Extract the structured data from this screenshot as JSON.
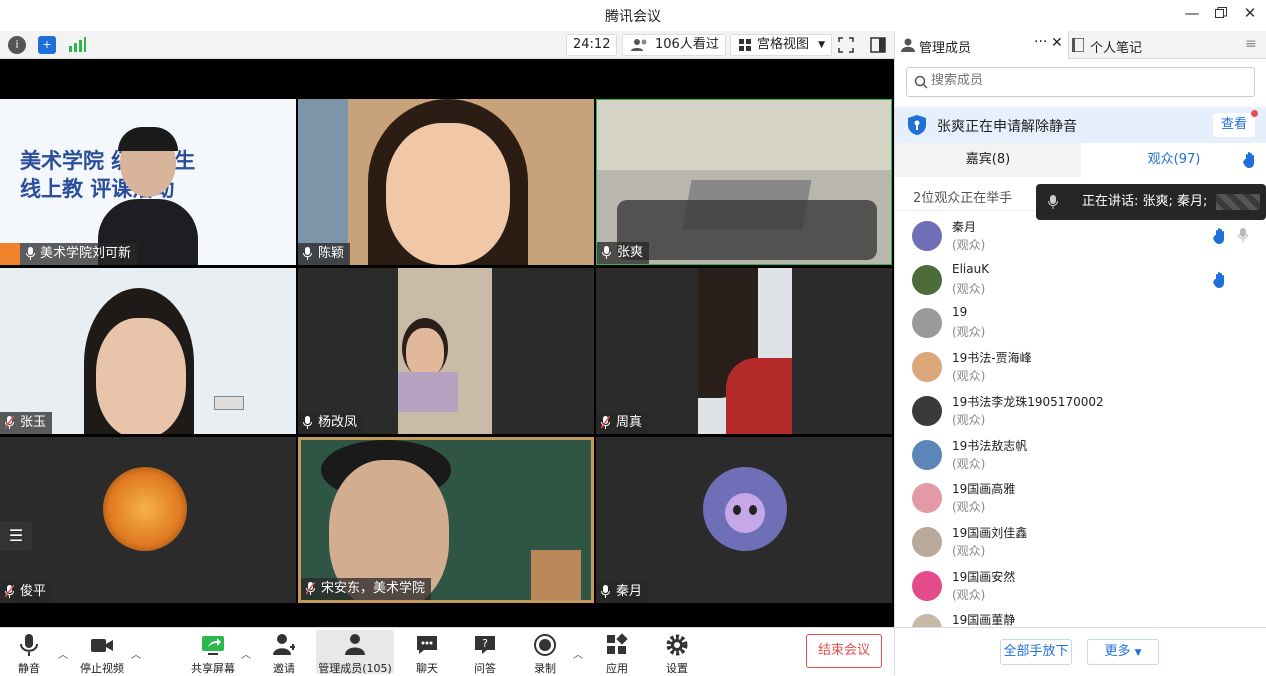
{
  "window": {
    "title": "腾讯会议"
  },
  "toolbar": {
    "timer": "24:12",
    "viewers": "106人看过",
    "view_mode": "宫格视图"
  },
  "tiles": [
    {
      "name": "美术学院刘可新",
      "bg": "#f4f7fb",
      "banner": "美术学院 级师范生\n线上教 评课活动"
    },
    {
      "name": "陈颖",
      "bg": "#c8a27a"
    },
    {
      "name": "张爽",
      "bg": "#7b7a72"
    },
    {
      "name": "张玉",
      "bg": "#e9eef3"
    },
    {
      "name": "杨改凤",
      "bg": "#2b2b2b"
    },
    {
      "name": "周真",
      "bg": "#2b2b2b"
    },
    {
      "name": "俊平",
      "bg": "#2b2b2b"
    },
    {
      "name": "宋安东，美术学院",
      "bg": "#2f5545"
    },
    {
      "name": "秦月",
      "bg": "#2b2b2b"
    }
  ],
  "right_panel": {
    "tab_members": "管理成员",
    "tab_notes": "个人笔记",
    "search_placeholder": "搜索成员",
    "unmute_request": "张爽正在申请解除静音",
    "view_label": "查看",
    "guests_tab": "嘉宾(8)",
    "audience_tab": "观众(97)",
    "handup_count": "2位观众正在举手",
    "speaking": "正在讲话: 张爽; 秦月;",
    "members": [
      {
        "name": "秦月",
        "role": "(观众)",
        "color": "#6f6fb8",
        "hand": true
      },
      {
        "name": "EliauK",
        "role": "(观众)",
        "color": "#4c6b3a",
        "hand": true
      },
      {
        "name": "19",
        "role": "(观众)",
        "color": "#9a9a9a",
        "hand": false
      },
      {
        "name": "19书法-贾海峰",
        "role": "(观众)",
        "color": "#d9a77a",
        "hand": false
      },
      {
        "name": "19书法李龙珠1905170002",
        "role": "(观众)",
        "color": "#3a3a3a",
        "hand": false
      },
      {
        "name": "19书法敖志帆",
        "role": "(观众)",
        "color": "#5d86b8",
        "hand": false
      },
      {
        "name": "19国画高雅",
        "role": "(观众)",
        "color": "#e39aa6",
        "hand": false
      },
      {
        "name": "19国画刘佳鑫",
        "role": "(观众)",
        "color": "#b9a99a",
        "hand": false
      },
      {
        "name": "19国画安然",
        "role": "(观众)",
        "color": "#e44b8a",
        "hand": false
      },
      {
        "name": "19国画董静",
        "role": "(观众)",
        "color": "#c8b8a8",
        "hand": false
      }
    ],
    "all_hands_down": "全部手放下",
    "more": "更多"
  },
  "bottombar": {
    "mute": "静音",
    "stop_video": "停止视频",
    "share_screen": "共享屏幕",
    "invite": "邀请",
    "manage_members": "管理成员(105)",
    "chat": "聊天",
    "qa": "问答",
    "record": "录制",
    "apps": "应用",
    "settings": "设置",
    "end_meeting": "结束会议"
  },
  "colors": {
    "accent": "#1f6fd8",
    "danger": "#e0504f"
  }
}
